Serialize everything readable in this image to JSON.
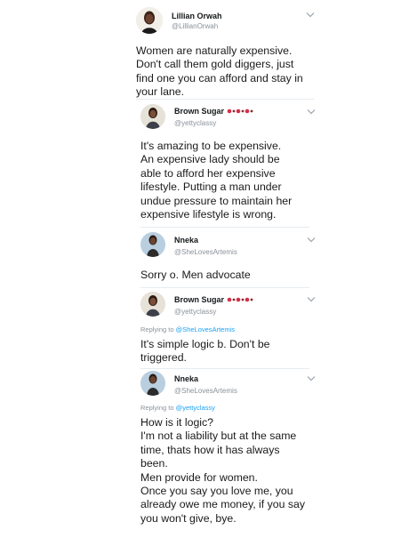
{
  "tweets": [
    {
      "name": "Lillian Orwah",
      "handle": "@LillianOrwah",
      "text": "Women are naturally expensive.\nDon't call them gold diggers, just\nfind one you can afford and stay in\nyour lane.",
      "avatar_icon": "woman-portrait-avatar"
    },
    {
      "name": "Brown Sugar",
      "handle": "@yettyclassy",
      "text": "It's amazing to be expensive.\nAn expensive lady should be\nable to afford her expensive\nlifestyle. Putting a man under\nundue pressure to maintain her\nexpensive lifestyle is wrong.",
      "emoji": "lipstick-kiss-emojis"
    },
    {
      "name": "Nneka",
      "handle": "@SheLovesArtemis",
      "text": "Sorry o. Men advocate"
    },
    {
      "name": "Brown Sugar",
      "handle": "@yettyclassy",
      "reply_prefix": "Replying to",
      "reply_to": "@SheLovesArtemis",
      "text": "It's simple logic b. Don't be\ntriggered.",
      "emoji": "lipstick-kiss-emojis"
    },
    {
      "name": "Nneka",
      "handle": "@SheLovesArtemis",
      "reply_prefix": "Replying to",
      "reply_to": "@yettyclassy",
      "text": "How is it logic?\nI'm not a liability but at the same\ntime, thats how it has always\nbeen.\nMen provide for women.\nOnce you say you love me, you\nalready owe me money, if you say\nyou won't give, bye."
    }
  ],
  "colors": {
    "text": "#14171a",
    "muted": "#8a9199",
    "link": "#1da1f2",
    "divider": "#e6ecf0"
  },
  "icons": [
    "chevron-down-icon",
    "lipstick-kiss-emoji"
  ]
}
